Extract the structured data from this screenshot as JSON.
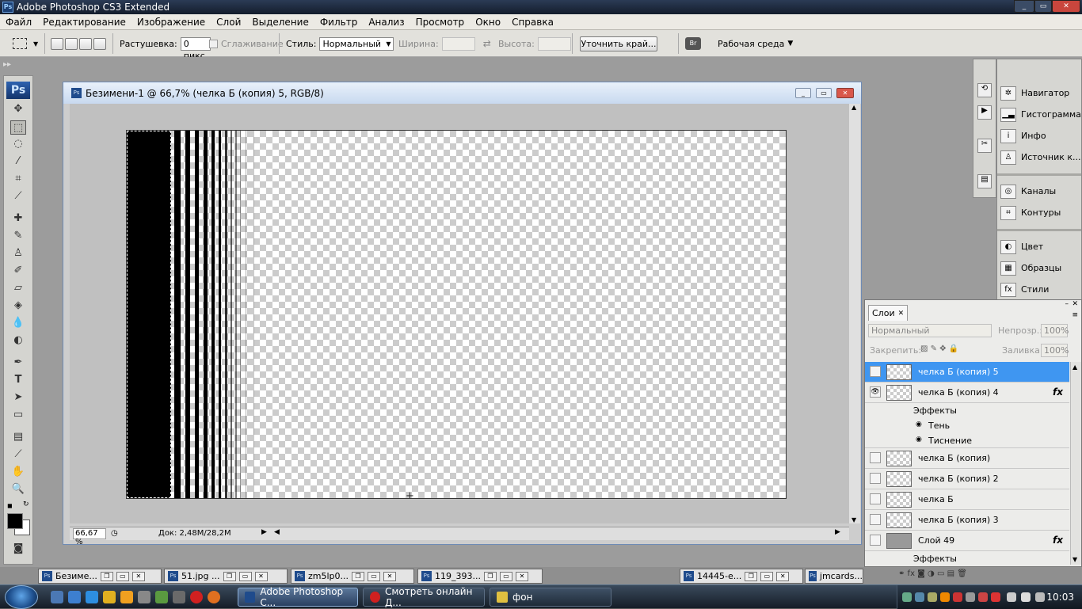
{
  "app": {
    "title": "Adobe Photoshop CS3 Extended",
    "logo": "Ps"
  },
  "menu": [
    "Файл",
    "Редактирование",
    "Изображение",
    "Слой",
    "Выделение",
    "Фильтр",
    "Анализ",
    "Просмотр",
    "Окно",
    "Справка"
  ],
  "options": {
    "feather_label": "Растушевка:",
    "feather_value": "0 пикс.",
    "antialias_label": "Сглаживание",
    "style_label": "Стиль:",
    "style_value": "Нормальный",
    "width_label": "Ширина:",
    "height_label": "Высота:",
    "refine_edge": "Уточнить край...",
    "workspace": "Рабочая среда"
  },
  "document": {
    "title": "Безимени-1 @ 66,7% (челка Б (копия) 5, RGB/8)",
    "zoom": "66,67 %",
    "doc_size": "Док: 2,48M/28,2M"
  },
  "panels": {
    "group1": [
      "Навигатор",
      "Гистограмма",
      "Инфо",
      "Источник к..."
    ],
    "group2": [
      "Каналы",
      "Контуры"
    ],
    "group3": [
      "Цвет",
      "Образцы",
      "Стили"
    ]
  },
  "layers_panel": {
    "tab": "Слои",
    "blend_mode": "Нормальный",
    "opacity_label": "Непрозр.:",
    "opacity_value": "100%",
    "lock_label": "Закрепить:",
    "fill_label": "Заливка:",
    "fill_value": "100%",
    "rows": [
      {
        "name": "челка Б (копия) 5",
        "selected": true,
        "visible": false,
        "fx": false
      },
      {
        "name": "челка Б (копия) 4",
        "selected": false,
        "visible": true,
        "fx": true
      },
      {
        "name": "Эффекты",
        "kind": "effects-header"
      },
      {
        "name": "Тень",
        "kind": "effect"
      },
      {
        "name": "Тиснение",
        "kind": "effect"
      },
      {
        "name": "челка Б (копия)",
        "selected": false,
        "visible": false,
        "fx": false
      },
      {
        "name": "челка Б (копия) 2",
        "selected": false,
        "visible": false,
        "fx": false
      },
      {
        "name": "челка Б",
        "selected": false,
        "visible": false,
        "fx": false
      },
      {
        "name": "челка Б (копия) 3",
        "selected": false,
        "visible": false,
        "fx": false
      },
      {
        "name": "Слой 49",
        "selected": false,
        "visible": false,
        "fx": true
      },
      {
        "name": "Эффекты",
        "kind": "effects-header"
      }
    ]
  },
  "minimized_docs": [
    "Безиме...",
    "51.jpg ...",
    "zm5lp0...",
    "119_393...",
    "14445-e...",
    "jmcards..."
  ],
  "taskbar": {
    "buttons": [
      "Adobe Photoshop C...",
      "Смотреть онлайн Д...",
      "фон"
    ],
    "clock": "10:03"
  }
}
